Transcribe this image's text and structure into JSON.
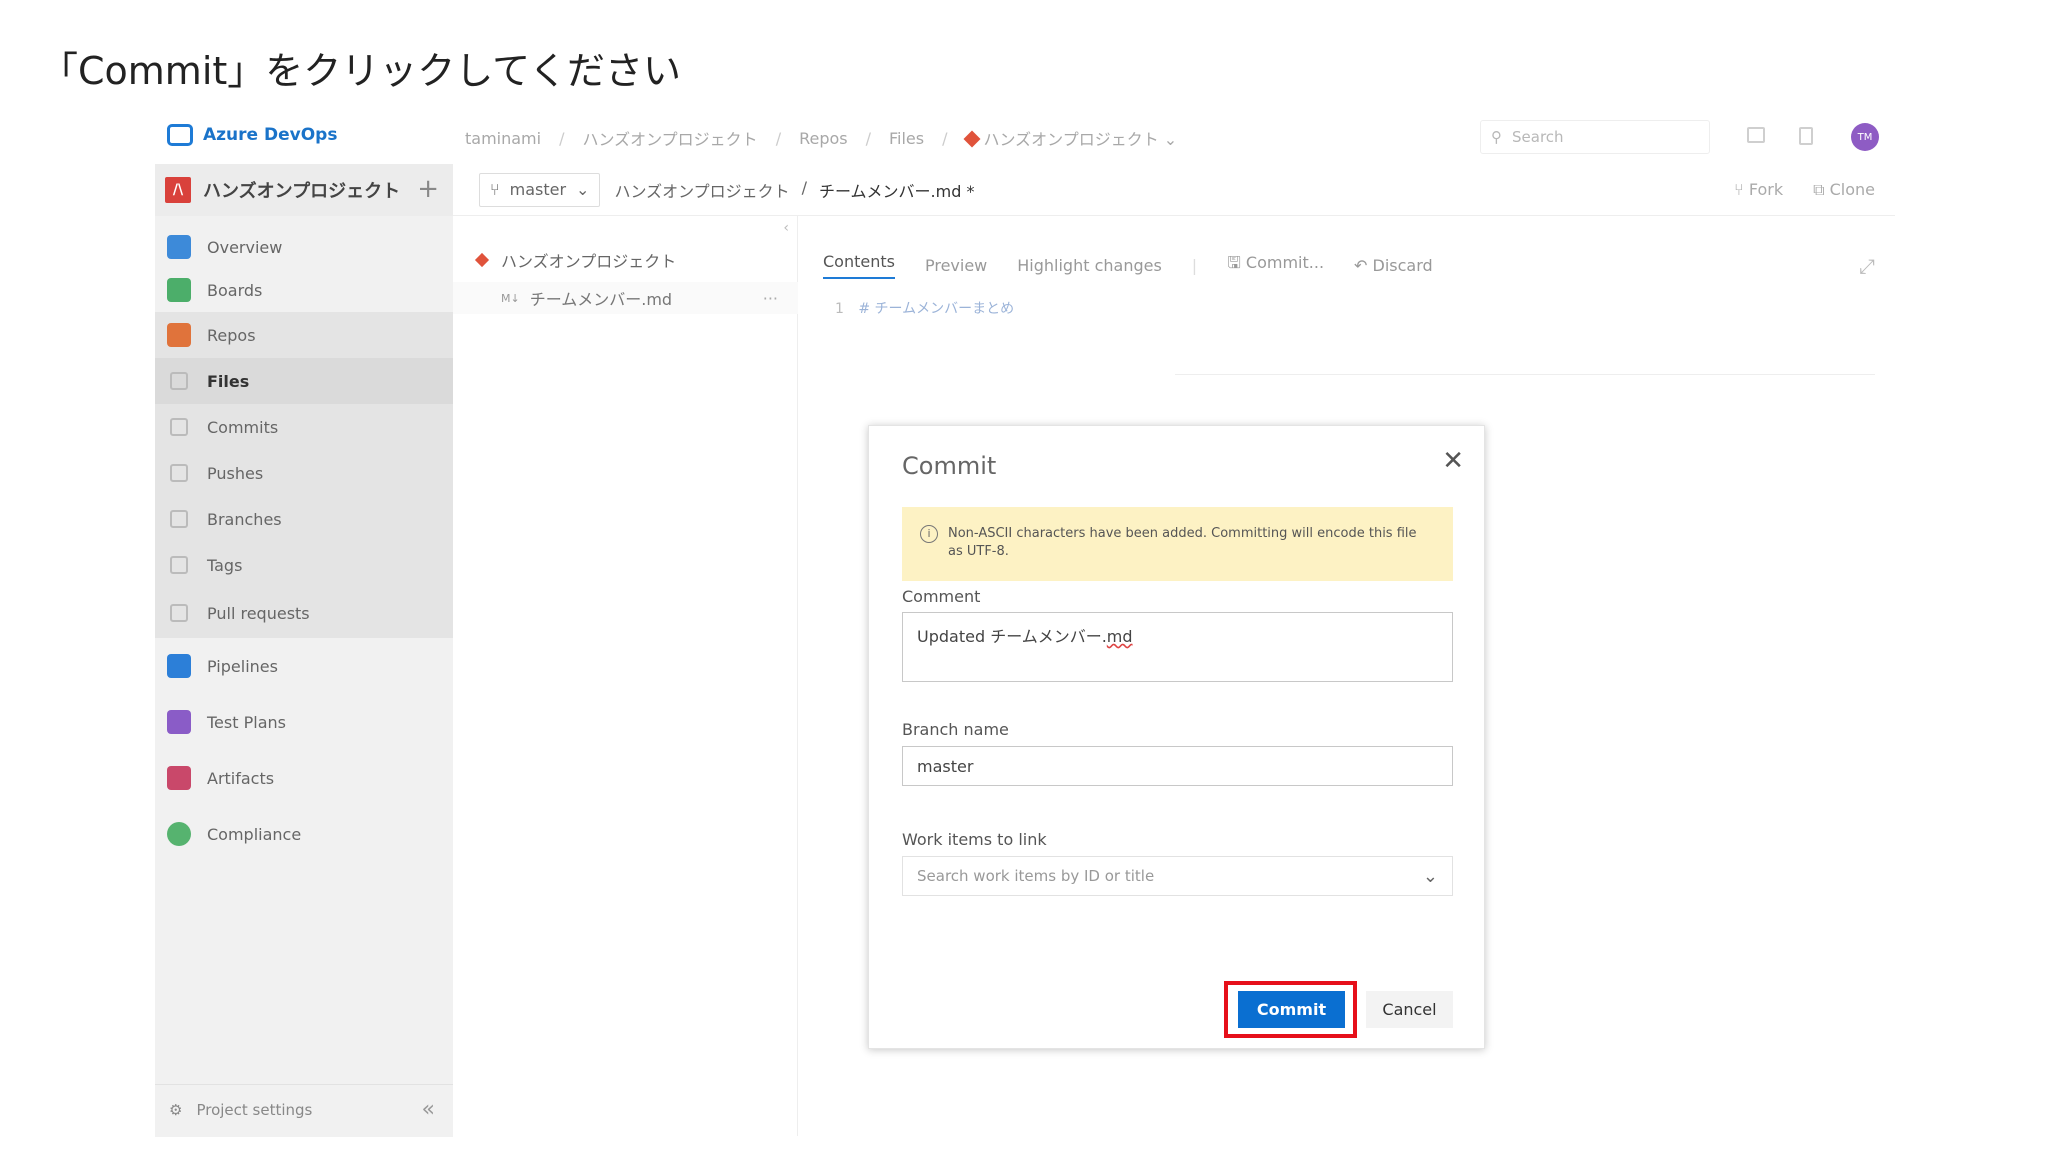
{
  "instruction": "「Commit」をクリックしてください",
  "topbar": {
    "brand": "Azure DevOps",
    "breadcrumbs": [
      "taminami",
      "ハンズオンプロジェクト",
      "Repos",
      "Files"
    ],
    "repo_picker": "ハンズオンプロジェクト",
    "search_placeholder": "Search",
    "avatar_initials": "TM"
  },
  "project": {
    "avatar_letter": "/\\",
    "name": "ハンズオンプロジェクト",
    "add": "+"
  },
  "sidebar": {
    "items": [
      {
        "label": "Overview",
        "color": "#3d8ad9"
      },
      {
        "label": "Boards",
        "color": "#4cae6a"
      },
      {
        "label": "Repos",
        "color": "#e0733b"
      },
      {
        "label": "Files"
      },
      {
        "label": "Commits"
      },
      {
        "label": "Pushes"
      },
      {
        "label": "Branches"
      },
      {
        "label": "Tags"
      },
      {
        "label": "Pull requests"
      },
      {
        "label": "Pipelines",
        "color": "#2c7fd8"
      },
      {
        "label": "Test Plans",
        "color": "#8a5cc7"
      },
      {
        "label": "Artifacts",
        "color": "#c9486a"
      },
      {
        "label": "Compliance",
        "color": "#56b36f"
      }
    ],
    "settings": "Project settings"
  },
  "subheader": {
    "branch": "master",
    "path_project": "ハンズオンプロジェクト",
    "path_sep": "/",
    "path_file": "チームメンバー.md *",
    "fork": "Fork",
    "clone": "Clone"
  },
  "tree": {
    "root": "ハンズオンプロジェクト",
    "file_prefix": "M↓",
    "file": "チームメンバー.md",
    "more": "···"
  },
  "editor": {
    "tabs": [
      "Contents",
      "Preview",
      "Highlight changes"
    ],
    "commit_action": "Commit...",
    "discard_action": "Discard",
    "line_number": "1",
    "line_text": "# チームメンバーまとめ"
  },
  "dialog": {
    "title": "Commit",
    "warning": "Non-ASCII characters have been added. Committing will encode this file as UTF-8.",
    "comment_label": "Comment",
    "comment_prefix": "Updated チームメンバー.",
    "comment_ext": "md",
    "branch_label": "Branch name",
    "branch_value": "master",
    "work_items_label": "Work items to link",
    "work_items_placeholder": "Search work items by ID or title",
    "commit_button": "Commit",
    "cancel_button": "Cancel",
    "highlight_color": "#e6101a"
  }
}
